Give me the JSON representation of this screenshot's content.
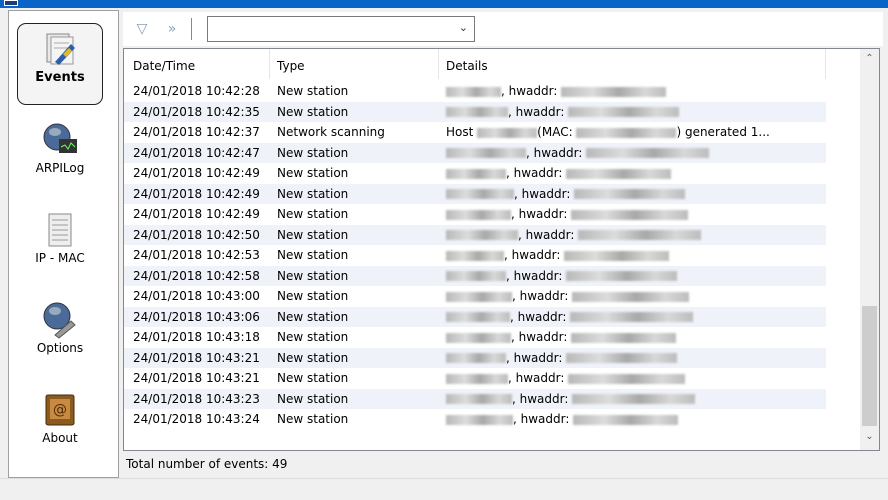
{
  "sidebar": {
    "items": [
      {
        "label": "Events",
        "icon": "events-icon",
        "active": true
      },
      {
        "label": "ARPILog",
        "icon": "globe-monitor-icon"
      },
      {
        "label": "IP - MAC",
        "icon": "document-icon"
      },
      {
        "label": "Options",
        "icon": "globe-wrench-icon"
      },
      {
        "label": "About",
        "icon": "book-icon"
      }
    ]
  },
  "toolbar": {
    "combo_value": ""
  },
  "table": {
    "columns": [
      "Date/Time",
      "Type",
      "Details"
    ],
    "rows": [
      [
        "24/01/2018 10:42:28",
        "New station",
        ", hwaddr:"
      ],
      [
        "24/01/2018 10:42:35",
        "New station",
        ", hwaddr:"
      ],
      [
        "24/01/2018 10:42:37",
        "Network scanning",
        "Host"
      ],
      [
        "24/01/2018 10:42:47",
        "New station",
        ", hwaddr:"
      ],
      [
        "24/01/2018 10:42:49",
        "New station",
        ", hwaddr:"
      ],
      [
        "24/01/2018 10:42:49",
        "New station",
        ", hwaddr:"
      ],
      [
        "24/01/2018 10:42:49",
        "New station",
        ", hwaddr:"
      ],
      [
        "24/01/2018 10:42:50",
        "New station",
        ", hwaddr:"
      ],
      [
        "24/01/2018 10:42:53",
        "New station",
        ", hwaddr:"
      ],
      [
        "24/01/2018 10:42:58",
        "New station",
        ", hwaddr:"
      ],
      [
        "24/01/2018 10:43:00",
        "New station",
        ", hwaddr:"
      ],
      [
        "24/01/2018 10:43:06",
        "New station",
        ", hwaddr:"
      ],
      [
        "24/01/2018 10:43:18",
        "New station",
        ", hwaddr:"
      ],
      [
        "24/01/2018 10:43:21",
        "New station",
        ", hwaddr:"
      ],
      [
        "24/01/2018 10:43:21",
        "New station",
        ", hwaddr:"
      ],
      [
        "24/01/2018 10:43:23",
        "New station",
        ", hwaddr:"
      ],
      [
        "24/01/2018 10:43:24",
        "New station",
        ", hwaddr:"
      ]
    ],
    "scan_mac_label": "(MAC:",
    "scan_suffix": ") generated 1..."
  },
  "status": "Total number of events: 49"
}
